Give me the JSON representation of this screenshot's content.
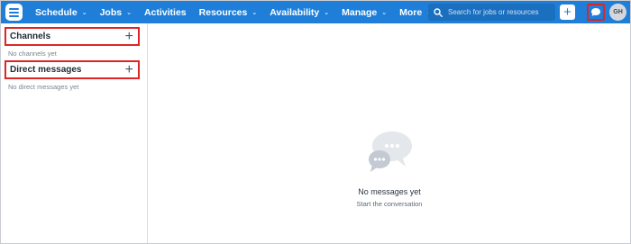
{
  "nav": {
    "items": [
      {
        "label": "Schedule",
        "dropdown": true
      },
      {
        "label": "Jobs",
        "dropdown": true
      },
      {
        "label": "Activities",
        "dropdown": false
      },
      {
        "label": "Resources",
        "dropdown": true
      },
      {
        "label": "Availability",
        "dropdown": true
      },
      {
        "label": "Manage",
        "dropdown": true
      },
      {
        "label": "More",
        "dropdown": true
      }
    ],
    "caret": "⌄"
  },
  "search": {
    "placeholder": "Search for jobs or resources"
  },
  "header": {
    "add_symbol": "+",
    "avatar_initials": "GH"
  },
  "sidebar": {
    "channels": {
      "title": "Channels",
      "add_symbol": "+",
      "empty": "No channels yet"
    },
    "direct_messages": {
      "title": "Direct messages",
      "add_symbol": "+",
      "empty": "No direct messages yet"
    }
  },
  "main": {
    "empty_title": "No messages yet",
    "empty_subtitle": "Start the conversation"
  },
  "colors": {
    "brand": "#1f7fd8",
    "highlight": "#e02424",
    "avatar_bg": "#d4d8de",
    "illustration": "#c4cad3"
  },
  "icons": [
    "logo-icon",
    "search-icon",
    "add-icon",
    "chat-icon",
    "chat-bubbles-icon"
  ]
}
